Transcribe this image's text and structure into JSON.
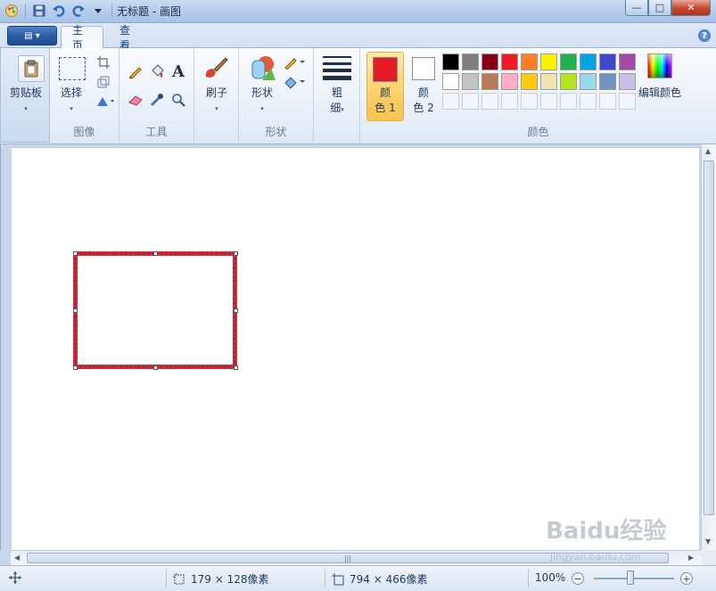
{
  "window": {
    "title": "无标题 - 画图",
    "minimize_glyph": "—",
    "maximize_glyph": "□",
    "close_glyph": "✕"
  },
  "tabs": {
    "menu_glyph": "▤ ▾",
    "home": "主页",
    "view": "查看",
    "help_glyph": "?"
  },
  "ribbon": {
    "clipboard": {
      "label": "剪贴板"
    },
    "image": {
      "select_label": "选择",
      "group_label": "图像"
    },
    "tools": {
      "group_label": "工具"
    },
    "brushes": {
      "label": "刷子"
    },
    "shapes": {
      "label": "形状",
      "group_label": "形状"
    },
    "size": {
      "label_line1": "粗",
      "label_line2": "细"
    },
    "colors": {
      "color1_line1": "颜",
      "color1_line2": "色 1",
      "color2_line1": "颜",
      "color2_line2": "色 2",
      "edit_label": "编辑颜色",
      "group_label": "颜色",
      "color1_value": "#e31c23",
      "color2_value": "#ffffff",
      "palette_row1": [
        "#000000",
        "#7f7f7f",
        "#880015",
        "#ed1c24",
        "#ff7f27",
        "#fff200",
        "#22b14c",
        "#00a2e8",
        "#3f48cc",
        "#a349a4"
      ],
      "palette_row2": [
        "#ffffff",
        "#c3c3c3",
        "#b97a57",
        "#ffaec9",
        "#ffc90e",
        "#efe4b0",
        "#b5e61d",
        "#99d9ea",
        "#7092be",
        "#c8bfe7"
      ]
    }
  },
  "canvas": {
    "shape_color": "#d9273a"
  },
  "status": {
    "selection_size": "179 × 128像素",
    "canvas_size": "794 × 466像素",
    "zoom": "100%",
    "zoom_minus": "−",
    "zoom_plus": "+"
  },
  "watermark": {
    "text": "Baidu经验",
    "sub": "jingyan.baidu.com"
  }
}
